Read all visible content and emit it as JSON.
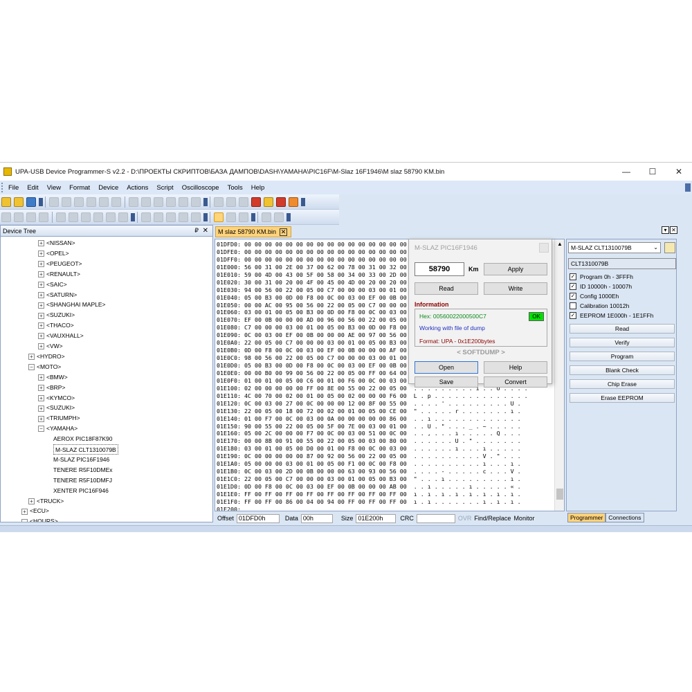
{
  "window": {
    "title": "UPA-USB Device Programmer-S v2.2 - D:\\ПРОЕКТЫ СКРИПТОВ\\БАЗА ДАМПОВ\\DASH\\YAMAHA\\PIC16F\\M-Slaz 16F1946\\M slaz  58790 KM.bin",
    "minimize": "—",
    "maximize": "☐",
    "close": "✕"
  },
  "menu": [
    "File",
    "Edit",
    "View",
    "Format",
    "Device",
    "Actions",
    "Script",
    "Oscilloscope",
    "Tools",
    "Help"
  ],
  "device_tree": {
    "header": "Device Tree",
    "pin": "₽",
    "close": "✕",
    "items": [
      {
        "label": "<NISSAN>",
        "level": 2,
        "toggle": "+"
      },
      {
        "label": "<OPEL>",
        "level": 2,
        "toggle": "+"
      },
      {
        "label": "<PEUGEOT>",
        "level": 2,
        "toggle": "+"
      },
      {
        "label": "<RENAULT>",
        "level": 2,
        "toggle": "+"
      },
      {
        "label": "<SAIC>",
        "level": 2,
        "toggle": "+"
      },
      {
        "label": "<SATURN>",
        "level": 2,
        "toggle": "+"
      },
      {
        "label": "<SHANGHAI MAPLE>",
        "level": 2,
        "toggle": "+"
      },
      {
        "label": "<SUZUKI>",
        "level": 2,
        "toggle": "+"
      },
      {
        "label": "<THACO>",
        "level": 2,
        "toggle": "+"
      },
      {
        "label": "<VAUXHALL>",
        "level": 2,
        "toggle": "+"
      },
      {
        "label": "<VW>",
        "level": 2,
        "toggle": "+"
      },
      {
        "label": "<HYDRO>",
        "level": 1,
        "toggle": "+"
      },
      {
        "label": "<MOTO>",
        "level": 1,
        "toggle": "−"
      },
      {
        "label": "<BMW>",
        "level": 2,
        "toggle": "+"
      },
      {
        "label": "<BRP>",
        "level": 2,
        "toggle": "+"
      },
      {
        "label": "<KYMCO>",
        "level": 2,
        "toggle": "+"
      },
      {
        "label": "<SUZUKI>",
        "level": 2,
        "toggle": "+"
      },
      {
        "label": "<TRIUMPH>",
        "level": 2,
        "toggle": "+"
      },
      {
        "label": "<YAMAHA>",
        "level": 2,
        "toggle": "−"
      },
      {
        "label": "AEROX PIC18F87K90",
        "level": 3,
        "toggle": ""
      },
      {
        "label": "M-SLAZ CLT1310079B",
        "level": 3,
        "toggle": "",
        "selected": true
      },
      {
        "label": "M-SLAZ PIC16F1946",
        "level": 3,
        "toggle": ""
      },
      {
        "label": "TENERE R5F10DMEx",
        "level": 3,
        "toggle": ""
      },
      {
        "label": "TENERE R5F10DMFJ",
        "level": 3,
        "toggle": ""
      },
      {
        "label": "XENTER PIC16F946",
        "level": 3,
        "toggle": ""
      },
      {
        "label": "<TRUCK>",
        "level": 1,
        "toggle": "+"
      },
      {
        "label": "<ECU>",
        "level": 0,
        "toggle": "+"
      },
      {
        "label": "<HOURS>",
        "level": 0,
        "toggle": "−"
      }
    ]
  },
  "doc_tab": {
    "label": "M slaz  58790 KM.bin",
    "close": "✕"
  },
  "hex_rows": [
    "01DFD0: 00 00 00 00 00 00 00 00 00 00 00 00 00 00 00 00",
    "01DFE0: 00 00 00 00 00 00 00 00 00 00 00 00 00 00 00 00",
    "01DFF0: 00 00 00 00 00 00 00 00 00 00 00 00 00 00 00 00",
    "01E000: 56 00 31 00 2E 00 37 00 62 00 78 00 31 00 32 00",
    "01E010: 59 00 4D 00 43 00 5F 00 58 00 34 00 33 00 2D 00",
    "01E020: 30 00 31 00 20 00 4F 00 45 00 4D 00 20 00 20 00",
    "01E030: 94 00 56 00 22 00 05 00 C7 00 00 00 03 00 01 00",
    "01E040: 05 00 B3 00 0D 00 F8 00 0C 00 03 00 EF 00 0B 00",
    "01E050: 00 00 AC 00 95 00 56 00 22 00 05 00 C7 00 00 00",
    "01E060: 03 00 01 00 05 00 B3 00 0D 00 F8 00 0C 00 03 00",
    "01E070: EF 00 0B 00 00 00 AD 00 96 00 56 00 22 00 05 00",
    "01E080: C7 00 00 00 03 00 01 00 05 00 B3 00 0D 00 F8 00",
    "01E090: 0C 00 03 00 EF 00 0B 00 00 00 AE 00 97 00 56 00",
    "01E0A0: 22 00 05 00 C7 00 00 00 03 00 01 00 05 00 B3 00",
    "01E0B0: 0D 00 F8 00 0C 00 03 00 EF 00 0B 00 00 00 AF 00",
    "01E0C0: 98 00 56 00 22 00 05 00 C7 00 00 00 03 00 01 00",
    "01E0D0: 05 00 B3 00 0D 00 F8 00 0C 00 03 00 EF 00 0B 00",
    "01E0E0: 00 00 B0 00 99 00 56 00 22 00 05 00 FF 00 64 00",
    "01E0F0: 01 00 01 00 05 00 C6 00 01 00 F6 00 0C 00 03 00",
    "01E100: 02 00 00 00 00 00 FF 00 8E 00 55 00 22 00 05 00  . . . . . . . . . ı . . U . . . .",
    "01E110: 4C 00 70 00 02 00 01 00 05 00 02 00 00 00 F6 00  L . p . . . . . . . . . . . . . .",
    "01E120: 0C 00 03 00 27 00 0C 00 00 00 12 00 8F 00 55 00  . . . . ' . . . . . . . . . U .",
    "01E130: 22 00 05 00 18 00 72 00 02 00 01 00 05 00 CE 00  \" . . . . . r . . . . . . . ı .",
    "01E140: 01 00 F7 00 0C 00 03 00 0A 00 00 00 00 00 86 00  . . ı . . . . . . . . . . . . .",
    "01E150: 90 00 55 00 22 00 05 00 5F 00 7E 00 03 00 01 00  . . U . \" . . . _ . ~ . . . . .",
    "01E160: 05 00 2C 00 00 00 F7 00 0C 00 03 00 51 00 0C 00  . . , . . . ı . . . . . Q . . .",
    "01E170: 00 00 8B 00 91 00 55 00 22 00 05 00 03 00 80 00  . . . . . . U . \" . . . . . . .",
    "01E180: 03 00 01 00 05 00 D0 00 01 00 F8 00 0C 00 03 00  . . . . . . ı . . . ı . . . . .",
    "01E190: 0C 00 00 00 00 00 87 00 92 00 56 00 22 00 05 00  . . . . . . . . . . V . \" . . .",
    "01E1A0: 05 00 00 00 03 00 01 00 05 00 F1 00 0C 00 F8 00  . . . . . . . . . . ı . . . ı .",
    "01E1B0: 0C 00 03 00 2D 00 0B 00 00 00 63 00 93 00 56 00  . . . . - . . . . . c . . . V .",
    "01E1C0: 22 00 05 00 C7 00 00 00 03 00 01 00 05 00 B3 00  \" . . . ı . . . . . . . . . ı .",
    "01E1D0: 0D 00 F8 00 0C 00 03 00 EF 00 0B 00 00 00 AB 00  . . ı . . . . . ı . . . . . « .",
    "01E1E0: FF 00 FF 00 FF 00 FF 00 FF 00 FF 00 FF 00 FF 00  ı . ı . ı . ı . ı . ı . ı . ı .",
    "01E1F0: FF 00 FF 00 86 00 04 00 94 00 FF 00 FF 00 FF 00  ı . ı . . . . . . . ı . ı . ı .",
    "01E200:"
  ],
  "hex_status": {
    "offset_label": "Offset",
    "offset_value": "01DFD0h",
    "data_label": "Data",
    "data_value": "00h",
    "size_label": "Size",
    "size_value": "01E200h",
    "crc_label": "CRC",
    "crc_value": "",
    "ovr": "OVR",
    "find_replace": "Find/Replace",
    "monitor": "Monitor"
  },
  "dialog": {
    "title": "M-SLAZ PIC16F1946",
    "km_value": "58790",
    "km_label": "Km",
    "apply": "Apply",
    "read": "Read",
    "write": "Write",
    "info_label": "Information",
    "hex": "Hex: 00560022000500C7",
    "ok": "OK",
    "working": "Working with file of dump",
    "format": "Format: UPA - 0x1E200bytes",
    "softdump": "< SOFTDUMP >",
    "open": "Open",
    "help": "Help",
    "save": "Save",
    "convert": "Convert"
  },
  "right_panel": {
    "device_combo": "M-SLAZ CLT1310079B",
    "chip_name": "CLT1310079B",
    "checks": [
      {
        "label": "Program 0h - 3FFFh",
        "checked": true
      },
      {
        "label": "ID 10000h - 10007h",
        "checked": true
      },
      {
        "label": "Config 1000Eh",
        "checked": true
      },
      {
        "label": "Calibration 10012h",
        "checked": false
      },
      {
        "label": "EEPROM 1E000h - 1E1FFh",
        "checked": true
      }
    ],
    "buttons": [
      "Read",
      "Verify",
      "Program",
      "Blank Check",
      "Chip Erase",
      "Erase EEPROM"
    ],
    "tabs": [
      "Programmer",
      "Connections"
    ]
  },
  "colors": {
    "accent_tab": "#ffd37a",
    "ok_green": "#00e000",
    "info_red": "#8b0000",
    "info_blue": "#2030c0",
    "hex_green": "#0a8a1a"
  }
}
